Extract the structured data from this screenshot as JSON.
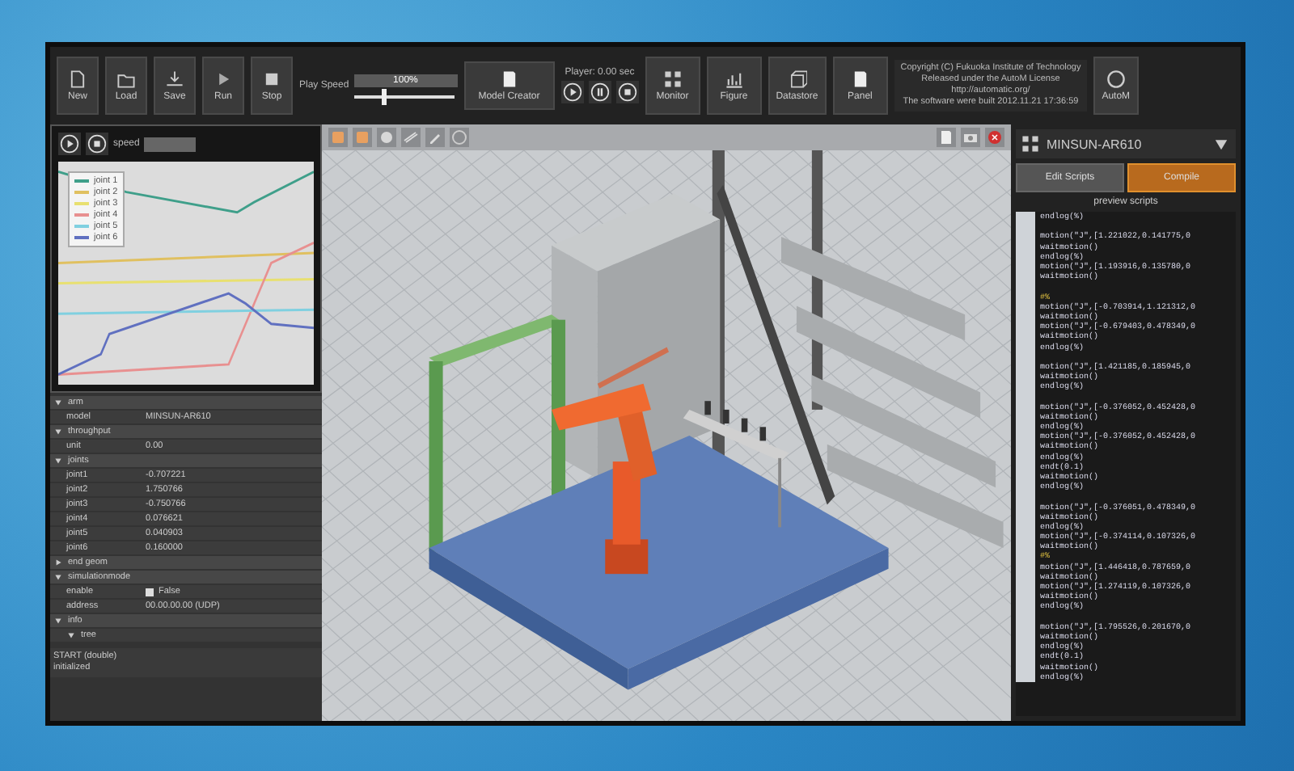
{
  "toolbar": {
    "buttons": [
      {
        "label": "New",
        "kind": "doc"
      },
      {
        "label": "Load",
        "kind": "folder"
      },
      {
        "label": "Save",
        "kind": "save"
      },
      {
        "label": "Run",
        "kind": "run"
      },
      {
        "label": "Stop",
        "kind": "stop"
      }
    ],
    "play_speed": {
      "label": "Play Speed",
      "value": "100%",
      "level": 0.3
    },
    "model_creator": "Model Creator",
    "player": {
      "label": "Player: 0.00 sec"
    },
    "menus": [
      {
        "label": "Monitor"
      },
      {
        "label": "Figure"
      },
      {
        "label": "Datastore"
      },
      {
        "label": "Panel"
      }
    ],
    "about": [
      "Copyright (C) Fukuoka Institute of Technology",
      "Released under the AutoM License",
      "http://automatic.org/",
      "The software were built 2012.11.21 17:36:59"
    ],
    "about_button": "AutoM"
  },
  "chart_window": {
    "speed_label": "speed",
    "legend": [
      {
        "label": "joint 1",
        "color": "#3f9f8a"
      },
      {
        "label": "joint 2",
        "color": "#e0c060"
      },
      {
        "label": "joint 3",
        "color": "#e8e070"
      },
      {
        "label": "joint 4",
        "color": "#e89090"
      },
      {
        "label": "joint 5",
        "color": "#80d0e0"
      },
      {
        "label": "joint 6",
        "color": "#6070c0"
      }
    ]
  },
  "properties": [
    {
      "label": "arm",
      "expanded": true,
      "children": [
        {
          "label": "model",
          "value": "MINSUN-AR610"
        }
      ]
    },
    {
      "label": "throughput",
      "expanded": true,
      "children": [
        {
          "label": "unit",
          "value": "0.00"
        }
      ]
    },
    {
      "label": "joints",
      "expanded": true,
      "children": [
        {
          "label": "joint1",
          "value": "-0.707221"
        },
        {
          "label": "joint2",
          "value": "1.750766"
        },
        {
          "label": "joint3",
          "value": "-0.750766"
        },
        {
          "label": "joint4",
          "value": "0.076621"
        },
        {
          "label": "joint5",
          "value": "0.040903"
        },
        {
          "label": "joint6",
          "value": "0.160000"
        }
      ]
    },
    {
      "label": "end geom",
      "expanded": false
    },
    {
      "label": "simulationmode",
      "expanded": true,
      "children": [
        {
          "label": "enable",
          "value": "False",
          "kind": "check",
          "checked": false
        },
        {
          "label": "address",
          "value": "00.00.00.00 (UDP)"
        }
      ]
    },
    {
      "label": "info",
      "expanded": true,
      "children": [
        {
          "label": "tree",
          "expanded": true
        }
      ]
    }
  ],
  "status_lines": [
    "START (double)",
    "initialized"
  ],
  "script_panel": {
    "robot": "MINSUN-AR610",
    "buttons": [
      {
        "label": "Edit Scripts",
        "selected": false
      },
      {
        "label": "Compile",
        "selected": true
      }
    ],
    "caption": "preview scripts",
    "lines": [
      {
        "kind": "code",
        "text": "endlog(%)"
      },
      {
        "kind": "blank"
      },
      {
        "kind": "code",
        "text": "motion(\"J\",[1.221022,0.141775,0"
      },
      {
        "kind": "code",
        "text": "waitmotion()"
      },
      {
        "kind": "code",
        "text": "endlog(%)"
      },
      {
        "kind": "code",
        "text": "motion(\"J\",[1.193916,0.135780,0"
      },
      {
        "kind": "code",
        "text": "waitmotion()"
      },
      {
        "kind": "blank"
      },
      {
        "kind": "marker",
        "text": "#%"
      },
      {
        "kind": "code",
        "text": "motion(\"J\",[-0.703914,1.121312,0"
      },
      {
        "kind": "code",
        "text": "waitmotion()"
      },
      {
        "kind": "code",
        "text": "motion(\"J\",[-0.679403,0.478349,0"
      },
      {
        "kind": "code",
        "text": "waitmotion()"
      },
      {
        "kind": "code",
        "text": "endlog(%)"
      },
      {
        "kind": "blank"
      },
      {
        "kind": "code",
        "text": "motion(\"J\",[1.421185,0.185945,0"
      },
      {
        "kind": "code",
        "text": "waitmotion()"
      },
      {
        "kind": "code",
        "text": "endlog(%)"
      },
      {
        "kind": "blank"
      },
      {
        "kind": "code",
        "text": "motion(\"J\",[-0.376052,0.452428,0"
      },
      {
        "kind": "code",
        "text": "waitmotion()"
      },
      {
        "kind": "code",
        "text": "endlog(%)"
      },
      {
        "kind": "code",
        "text": "motion(\"J\",[-0.376052,0.452428,0"
      },
      {
        "kind": "code",
        "text": "waitmotion()"
      },
      {
        "kind": "code",
        "text": "endlog(%)"
      },
      {
        "kind": "code",
        "text": "endt(0.1)"
      },
      {
        "kind": "code",
        "text": "waitmotion()"
      },
      {
        "kind": "code",
        "text": "endlog(%)"
      },
      {
        "kind": "blank"
      },
      {
        "kind": "code",
        "text": "motion(\"J\",[-0.376051,0.478349,0"
      },
      {
        "kind": "code",
        "text": "waitmotion()"
      },
      {
        "kind": "code",
        "text": "endlog(%)"
      },
      {
        "kind": "code",
        "text": "motion(\"J\",[-0.374114,0.107326,0"
      },
      {
        "kind": "code",
        "text": "waitmotion()"
      },
      {
        "kind": "marker",
        "text": "#%"
      },
      {
        "kind": "code",
        "text": "motion(\"J\",[1.446418,0.787659,0"
      },
      {
        "kind": "code",
        "text": "waitmotion()"
      },
      {
        "kind": "code",
        "text": "motion(\"J\",[1.274119,0.107326,0"
      },
      {
        "kind": "code",
        "text": "waitmotion()"
      },
      {
        "kind": "code",
        "text": "endlog(%)"
      },
      {
        "kind": "blank"
      },
      {
        "kind": "code",
        "text": "motion(\"J\",[1.795526,0.201670,0"
      },
      {
        "kind": "code",
        "text": "waitmotion()"
      },
      {
        "kind": "code",
        "text": "endlog(%)"
      },
      {
        "kind": "code",
        "text": "endt(0.1)"
      },
      {
        "kind": "code",
        "text": "waitmotion()"
      },
      {
        "kind": "code",
        "text": "endlog(%)"
      }
    ]
  }
}
